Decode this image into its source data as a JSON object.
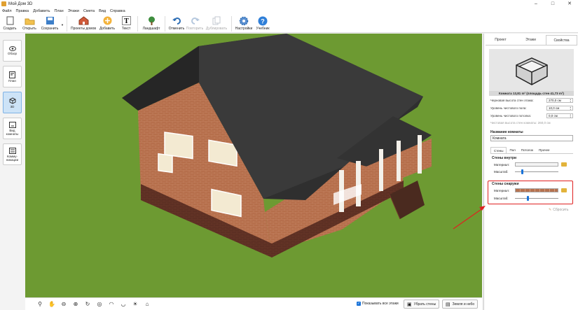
{
  "window": {
    "title": "Мой Дом 3D"
  },
  "menu": [
    "Файл",
    "Правка",
    "Добавить",
    "План",
    "Этажи",
    "Смета",
    "Вид",
    "Справка"
  ],
  "toolbar": {
    "create": "Создать",
    "open": "Открыть",
    "save": "Сохранить",
    "projects": "Проекты домов",
    "add": "Добавить",
    "text": "Текст",
    "landscape": "Ландшафт",
    "undo": "Отменить",
    "redo": "Повторить",
    "duplicate": "Дублировать",
    "settings": "Настройки",
    "tutorial": "Учебник"
  },
  "sidebar": {
    "overview": "Обзор",
    "plan": "План",
    "view3d": "3D",
    "room_view": "Вид комнаты",
    "communications": "Комму- никации"
  },
  "bottombar": {
    "show_all_floors": "Показывать все этажи",
    "remove_walls": "Убрать стены",
    "zoom_sky": "Земля и небо"
  },
  "panel": {
    "tabs": [
      "Проект",
      "Этажи",
      "Свойства"
    ],
    "active_tab": "Свойства",
    "room_caption": "Комната 13,81 m² (площадь стен 41,73 m²)",
    "props": [
      {
        "label": "Черновая высота стен этажа:",
        "value": "270,0 см"
      },
      {
        "label": "Уровень чистового пола:",
        "value": "10,0 см"
      },
      {
        "label": "Уровень чистового потолка:",
        "value": "0,0 см"
      }
    ],
    "clean_height": "Чистовая высота стен комнаты: 260,0 см",
    "room_name_title": "Название комнаты",
    "room_name_value": "Комната",
    "subtabs": [
      "Стены",
      "Пол",
      "Потолок",
      "Прочее"
    ],
    "inside_title": "Стены внутри",
    "outside_title": "Стены снаружи",
    "material_label": "Материал:",
    "scale_label": "Масштаб:",
    "reset": "Сбросить",
    "inside_scale": 0.14,
    "outside_scale": 0.27,
    "brick_color": "#b57250"
  },
  "colors": {
    "accent": "#1a73d9",
    "grass": "#6d9a32",
    "highlight": "#e02020"
  }
}
